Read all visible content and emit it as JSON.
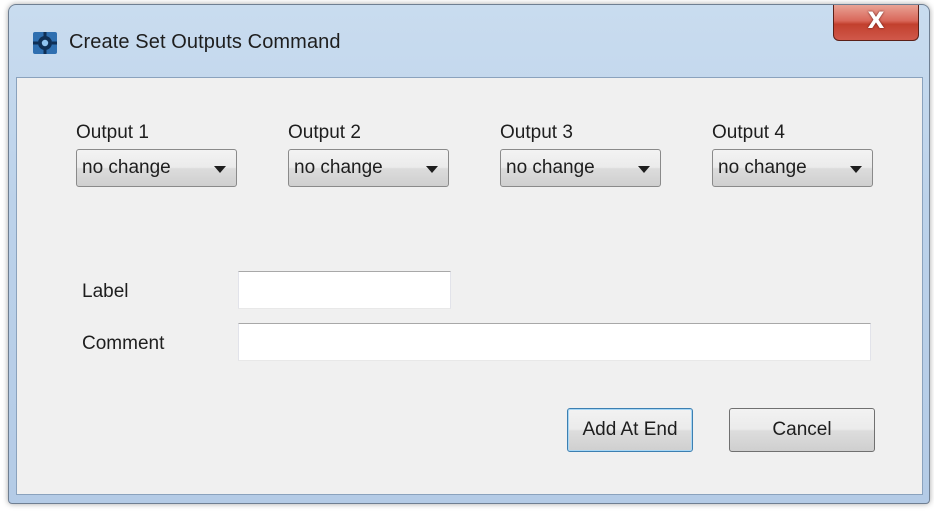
{
  "window": {
    "title": "Create Set Outputs Command",
    "close_symbol": "X",
    "app_icon": "gear-icon"
  },
  "outputs": [
    {
      "label": "Output 1",
      "value": "no change"
    },
    {
      "label": "Output 2",
      "value": "no change"
    },
    {
      "label": "Output 3",
      "value": "no change"
    },
    {
      "label": "Output 4",
      "value": "no change"
    }
  ],
  "fields": {
    "label": {
      "label": "Label",
      "value": ""
    },
    "comment": {
      "label": "Comment",
      "value": ""
    }
  },
  "buttons": {
    "add_at_end": "Add At End",
    "cancel": "Cancel"
  },
  "colors": {
    "close_button": "#c9463a",
    "frame": "#b9d0e9",
    "client_bg": "#f0f0f0"
  }
}
